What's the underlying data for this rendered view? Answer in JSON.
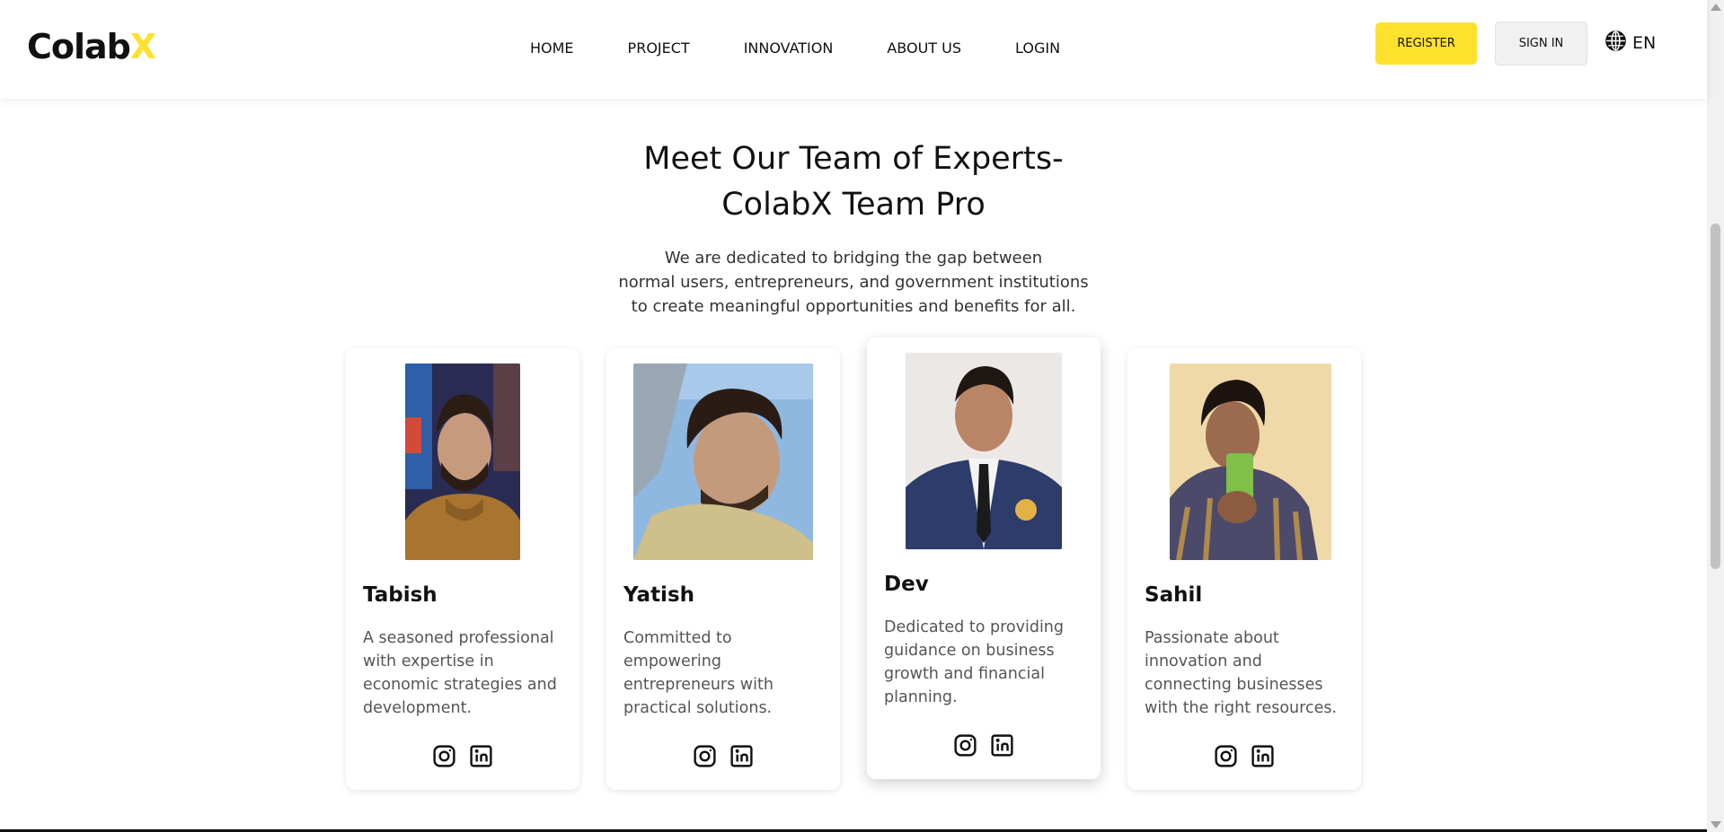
{
  "header": {
    "logo_main": "Colab",
    "logo_accent": "X",
    "nav": [
      "HOME",
      "PROJECT",
      "INNOVATION",
      "ABOUT US",
      "LOGIN"
    ],
    "register_label": "REGISTER",
    "signin_label": "SIGN IN",
    "language": "EN",
    "language_icon": "globe-icon"
  },
  "section": {
    "title_line1": "Meet Our Team of Experts-",
    "title_line2": "ColabX Team Pro",
    "subtitle_line1": "We are dedicated to bridging the gap between",
    "subtitle_line2": "normal users, entrepreneurs, and government institutions",
    "subtitle_line3": "to create meaningful opportunities and benefits for all."
  },
  "team": [
    {
      "name": "Tabish",
      "description": "A seasoned professional with expertise in economic strategies and development.",
      "icons": [
        "instagram-icon",
        "linkedin-icon"
      ]
    },
    {
      "name": "Yatish",
      "description": "Committed to empowering entrepreneurs with practical solutions.",
      "icons": [
        "instagram-icon",
        "linkedin-icon"
      ]
    },
    {
      "name": "Dev",
      "description": "Dedicated to providing guidance on business growth and financial planning.",
      "icons": [
        "instagram-icon",
        "linkedin-icon"
      ]
    },
    {
      "name": "Sahil",
      "description": "Passionate about innovation and connecting businesses with the right resources.",
      "icons": [
        "instagram-icon",
        "linkedin-icon"
      ]
    }
  ],
  "colors": {
    "accent": "#fde12d",
    "signin_bg": "#f1f1f1",
    "text": "#111111",
    "muted_text": "#555555"
  }
}
